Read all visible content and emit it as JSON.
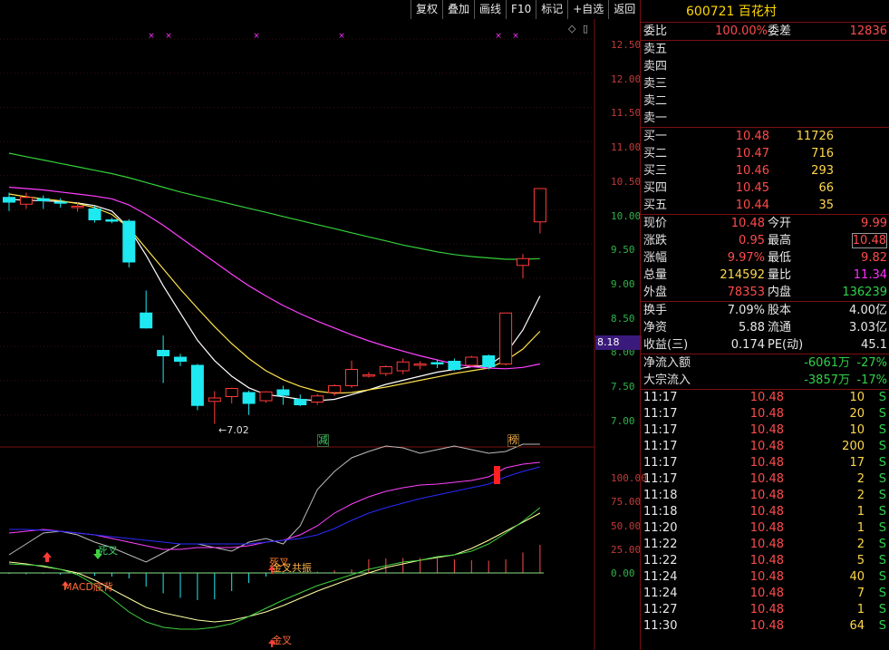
{
  "toolbar": {
    "buttons": [
      "复权",
      "叠加",
      "画线",
      "F10",
      "标记",
      "+自选",
      "返回"
    ]
  },
  "chart": {
    "corner_icons": [
      "◇",
      "▯"
    ],
    "y_ticks": [
      "12.50",
      "12.00",
      "11.50",
      "11.00",
      "10.50",
      "10.00",
      "9.50",
      "9.00",
      "8.50",
      "8.00",
      "7.50",
      "7.00"
    ],
    "low_annotation": "←7.02",
    "current_price_tag": "8.18",
    "label_jian": "减",
    "label_bang": "榜",
    "sub_y_ticks": [
      "100.00",
      "75.00",
      "50.00",
      "25.00",
      "0.00"
    ],
    "sub_annotations": {
      "jiancha": "死叉",
      "jincha_gongzhen": "金叉共振",
      "macd_dibeili": "MACD底背",
      "jincha": "金叉",
      "sicha_top": "死叉"
    }
  },
  "chart_data": {
    "type": "candlestick",
    "price_range": [
      6.8,
      12.8
    ],
    "candles": [
      {
        "o": 10.35,
        "h": 10.42,
        "l": 10.15,
        "c": 10.28
      },
      {
        "o": 10.25,
        "h": 10.42,
        "l": 10.18,
        "c": 10.35
      },
      {
        "o": 10.33,
        "h": 10.38,
        "l": 10.18,
        "c": 10.3
      },
      {
        "o": 10.28,
        "h": 10.34,
        "l": 10.2,
        "c": 10.27
      },
      {
        "o": 10.2,
        "h": 10.28,
        "l": 10.14,
        "c": 10.22
      },
      {
        "o": 10.18,
        "h": 10.22,
        "l": 9.98,
        "c": 10.02
      },
      {
        "o": 10.02,
        "h": 10.05,
        "l": 9.97,
        "c": 10.0
      },
      {
        "o": 10.0,
        "h": 10.03,
        "l": 9.32,
        "c": 9.4
      },
      {
        "o": 8.65,
        "h": 8.98,
        "l": 8.42,
        "c": 8.43
      },
      {
        "o": 8.1,
        "h": 8.32,
        "l": 7.62,
        "c": 8.02
      },
      {
        "o": 8.0,
        "h": 8.05,
        "l": 7.87,
        "c": 7.94
      },
      {
        "o": 7.88,
        "h": 7.9,
        "l": 7.22,
        "c": 7.29
      },
      {
        "o": 7.35,
        "h": 7.5,
        "l": 7.02,
        "c": 7.4
      },
      {
        "o": 7.42,
        "h": 7.55,
        "l": 7.32,
        "c": 7.54
      },
      {
        "o": 7.48,
        "h": 7.51,
        "l": 7.15,
        "c": 7.32
      },
      {
        "o": 7.36,
        "h": 7.5,
        "l": 7.33,
        "c": 7.49
      },
      {
        "o": 7.52,
        "h": 7.58,
        "l": 7.3,
        "c": 7.44
      },
      {
        "o": 7.38,
        "h": 7.45,
        "l": 7.28,
        "c": 7.3
      },
      {
        "o": 7.34,
        "h": 7.46,
        "l": 7.3,
        "c": 7.43
      },
      {
        "o": 7.48,
        "h": 7.6,
        "l": 7.43,
        "c": 7.58
      },
      {
        "o": 7.58,
        "h": 7.95,
        "l": 7.55,
        "c": 7.82
      },
      {
        "o": 7.72,
        "h": 7.78,
        "l": 7.7,
        "c": 7.74
      },
      {
        "o": 7.76,
        "h": 7.88,
        "l": 7.72,
        "c": 7.86
      },
      {
        "o": 7.8,
        "h": 7.98,
        "l": 7.75,
        "c": 7.93
      },
      {
        "o": 7.88,
        "h": 7.94,
        "l": 7.82,
        "c": 7.9
      },
      {
        "o": 7.92,
        "h": 7.96,
        "l": 7.84,
        "c": 7.9
      },
      {
        "o": 7.94,
        "h": 7.98,
        "l": 7.8,
        "c": 7.82
      },
      {
        "o": 7.88,
        "h": 8.02,
        "l": 7.86,
        "c": 8.0
      },
      {
        "o": 8.02,
        "h": 8.04,
        "l": 7.82,
        "c": 7.86
      },
      {
        "o": 7.9,
        "h": 8.65,
        "l": 7.88,
        "c": 8.65
      },
      {
        "o": 9.35,
        "h": 9.52,
        "l": 9.16,
        "c": 9.45
      },
      {
        "o": 9.99,
        "h": 10.48,
        "l": 9.82,
        "c": 10.48
      }
    ],
    "ma_series": [
      {
        "color": "#ffffff",
        "values": [
          10.32,
          10.31,
          10.3,
          10.29,
          10.27,
          10.23,
          10.15,
          9.9,
          9.5,
          9.05,
          8.65,
          8.25,
          7.95,
          7.72,
          7.55,
          7.45,
          7.42,
          7.38,
          7.36,
          7.38,
          7.45,
          7.52,
          7.6,
          7.66,
          7.72,
          7.78,
          7.82,
          7.86,
          7.88,
          8.05,
          8.4,
          8.9
        ]
      },
      {
        "color": "#ffe34a",
        "values": [
          10.4,
          10.36,
          10.33,
          10.3,
          10.26,
          10.2,
          10.1,
          9.9,
          9.6,
          9.3,
          9.0,
          8.72,
          8.45,
          8.2,
          7.98,
          7.8,
          7.67,
          7.57,
          7.5,
          7.47,
          7.48,
          7.52,
          7.56,
          7.61,
          7.66,
          7.71,
          7.76,
          7.8,
          7.84,
          7.95,
          8.12,
          8.38
        ]
      },
      {
        "color": "#ff40ff",
        "values": [
          10.5,
          10.48,
          10.46,
          10.43,
          10.4,
          10.37,
          10.33,
          10.24,
          10.1,
          9.94,
          9.76,
          9.58,
          9.4,
          9.22,
          9.05,
          8.9,
          8.76,
          8.64,
          8.53,
          8.43,
          8.33,
          8.24,
          8.16,
          8.09,
          8.02,
          7.96,
          7.9,
          7.86,
          7.84,
          7.83,
          7.85,
          7.9
        ]
      },
      {
        "color": "#34d03a",
        "values": [
          11.0,
          10.95,
          10.9,
          10.85,
          10.8,
          10.75,
          10.7,
          10.64,
          10.57,
          10.5,
          10.43,
          10.37,
          10.31,
          10.25,
          10.19,
          10.13,
          10.07,
          10.01,
          9.95,
          9.89,
          9.83,
          9.77,
          9.71,
          9.65,
          9.6,
          9.55,
          9.51,
          9.48,
          9.46,
          9.44,
          9.44,
          9.45
        ]
      }
    ]
  },
  "panel": {
    "code": "600721",
    "name": "百花村",
    "weibi_label": "委比",
    "weibi_value": "100.00%",
    "weicha_label": "委差",
    "weicha_value": "12836",
    "sells": [
      {
        "label": "卖五"
      },
      {
        "label": "卖四"
      },
      {
        "label": "卖三"
      },
      {
        "label": "卖二"
      },
      {
        "label": "卖一"
      }
    ],
    "buys": [
      {
        "label": "买一",
        "price": "10.48",
        "vol": "11726"
      },
      {
        "label": "买二",
        "price": "10.47",
        "vol": "716"
      },
      {
        "label": "买三",
        "price": "10.46",
        "vol": "293"
      },
      {
        "label": "买四",
        "price": "10.45",
        "vol": "66"
      },
      {
        "label": "买五",
        "price": "10.44",
        "vol": "35"
      }
    ],
    "quote": [
      {
        "l1": "现价",
        "v1": "10.48",
        "c1": "red",
        "l2": "今开",
        "v2": "9.99",
        "c2": "red"
      },
      {
        "l1": "涨跌",
        "v1": "0.95",
        "c1": "red",
        "l2": "最高",
        "v2": "10.48",
        "c2": "red"
      },
      {
        "l1": "涨幅",
        "v1": "9.97%",
        "c1": "red",
        "l2": "最低",
        "v2": "9.82",
        "c2": "red"
      },
      {
        "l1": "总量",
        "v1": "214592",
        "c1": "yellow",
        "l2": "量比",
        "v2": "11.34",
        "c2": "magenta"
      },
      {
        "l1": "外盘",
        "v1": "78353",
        "c1": "red",
        "l2": "内盘",
        "v2": "136239",
        "c2": "green"
      }
    ],
    "fund": [
      {
        "l1": "换手",
        "v1": "7.09%",
        "l2": "股本",
        "v2": "4.00亿"
      },
      {
        "l1": "净资",
        "v1": "5.88",
        "l2": "流通",
        "v2": "3.03亿"
      },
      {
        "l1": "收益(三)",
        "v1": "0.174",
        "l2": "PE(动)",
        "v2": "45.1"
      }
    ],
    "flow": [
      {
        "label": "净流入额",
        "value": "-6061万",
        "pct": "-27%"
      },
      {
        "label": "大宗流入",
        "value": "-3857万",
        "pct": "-17%"
      }
    ],
    "ticks": [
      {
        "t": "11:17",
        "p": "10.48",
        "v": "10",
        "s": "S"
      },
      {
        "t": "11:17",
        "p": "10.48",
        "v": "20",
        "s": "S"
      },
      {
        "t": "11:17",
        "p": "10.48",
        "v": "10",
        "s": "S"
      },
      {
        "t": "11:17",
        "p": "10.48",
        "v": "200",
        "s": "S"
      },
      {
        "t": "11:17",
        "p": "10.48",
        "v": "17",
        "s": "S"
      },
      {
        "t": "11:17",
        "p": "10.48",
        "v": "2",
        "s": "S"
      },
      {
        "t": "11:18",
        "p": "10.48",
        "v": "2",
        "s": "S"
      },
      {
        "t": "11:18",
        "p": "10.48",
        "v": "1",
        "s": "S"
      },
      {
        "t": "11:20",
        "p": "10.48",
        "v": "1",
        "s": "S"
      },
      {
        "t": "11:22",
        "p": "10.48",
        "v": "2",
        "s": "S"
      },
      {
        "t": "11:22",
        "p": "10.48",
        "v": "5",
        "s": "S"
      },
      {
        "t": "11:24",
        "p": "10.48",
        "v": "40",
        "s": "S"
      },
      {
        "t": "11:24",
        "p": "10.48",
        "v": "7",
        "s": "S"
      },
      {
        "t": "11:27",
        "p": "10.48",
        "v": "1",
        "s": "S"
      },
      {
        "t": "11:30",
        "p": "10.48",
        "v": "64",
        "s": "S"
      }
    ]
  }
}
